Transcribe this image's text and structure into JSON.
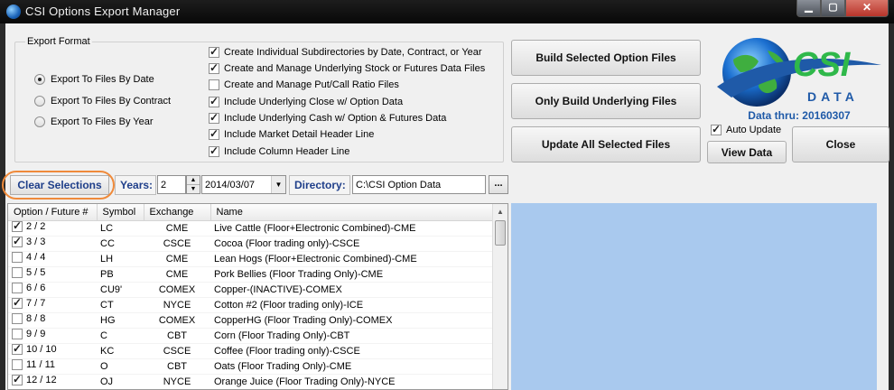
{
  "window": {
    "title": "CSI Options Export Manager",
    "min": "▁",
    "max": "▢",
    "close": "✕"
  },
  "export_format": {
    "legend": "Export Format",
    "radios": [
      {
        "label": "Export To Files By Date",
        "selected": true
      },
      {
        "label": "Export To Files By Contract",
        "selected": false
      },
      {
        "label": "Export To Files By Year",
        "selected": false
      }
    ],
    "checks": [
      {
        "label": "Create Individual Subdirectories by Date, Contract, or Year",
        "checked": true
      },
      {
        "label": "Create and Manage Underlying Stock or Futures Data Files",
        "checked": true
      },
      {
        "label": "Create and Manage Put/Call Ratio Files",
        "checked": false
      },
      {
        "label": "Include Underlying Close w/ Option Data",
        "checked": true
      },
      {
        "label": "Include Underlying Cash w/ Option & Futures Data",
        "checked": true
      },
      {
        "label": "Include Market Detail Header Line",
        "checked": true
      },
      {
        "label": "Include Column Header Line",
        "checked": true
      }
    ]
  },
  "buttons": {
    "build_selected": "Build Selected Option Files",
    "only_underlying": "Only Build Underlying Files",
    "update_all": "Update All Selected Files",
    "view_data": "View Data",
    "close": "Close",
    "clear": "Clear Selections",
    "browse": "..."
  },
  "logo": {
    "text": "CSI",
    "subtext": "DATA",
    "data_thru": "Data thru: 20160307"
  },
  "auto_update": {
    "label": "Auto Update",
    "checked": true
  },
  "toolbar": {
    "years_label": "Years:",
    "years_value": "2",
    "date_value": "2014/03/07",
    "directory_label": "Directory:",
    "directory_value": "C:\\CSI Option Data"
  },
  "table": {
    "columns": [
      "Option / Future #",
      "Symbol",
      "Exchange",
      "Name"
    ],
    "rows": [
      {
        "num": "2 / 2",
        "symbol": "LC",
        "exchange": "CME",
        "name": "Live Cattle (Floor+Electronic Combined)-CME",
        "checked": true
      },
      {
        "num": "3 / 3",
        "symbol": "CC",
        "exchange": "CSCE",
        "name": "Cocoa (Floor trading only)-CSCE",
        "checked": true
      },
      {
        "num": "4 / 4",
        "symbol": "LH",
        "exchange": "CME",
        "name": "Lean Hogs (Floor+Electronic Combined)-CME",
        "checked": false
      },
      {
        "num": "5 / 5",
        "symbol": "PB",
        "exchange": "CME",
        "name": "Pork Bellies (Floor Trading Only)-CME",
        "checked": false
      },
      {
        "num": "6 / 6",
        "symbol": "CU9'",
        "exchange": "COMEX",
        "name": "Copper-(INACTIVE)-COMEX",
        "checked": false
      },
      {
        "num": "7 / 7",
        "symbol": "CT",
        "exchange": "NYCE",
        "name": "Cotton #2 (Floor trading only)-ICE",
        "checked": true
      },
      {
        "num": "8 / 8",
        "symbol": "HG",
        "exchange": "COMEX",
        "name": "CopperHG (Floor Trading Only)-COMEX",
        "checked": false
      },
      {
        "num": "9 / 9",
        "symbol": "C",
        "exchange": "CBT",
        "name": "Corn (Floor Trading Only)-CBT",
        "checked": false
      },
      {
        "num": "10 / 10",
        "symbol": "KC",
        "exchange": "CSCE",
        "name": "Coffee (Floor trading only)-CSCE",
        "checked": true
      },
      {
        "num": "11 / 11",
        "symbol": "O",
        "exchange": "CBT",
        "name": "Oats (Floor Trading Only)-CME",
        "checked": false
      },
      {
        "num": "12 / 12",
        "symbol": "OJ",
        "exchange": "NYCE",
        "name": "Orange Juice (Floor Trading Only)-NYCE",
        "checked": true
      }
    ]
  },
  "colors": {
    "accent_label": "#1f3f8a",
    "highlight_ring": "#ef8a3a",
    "panel_blue": "#a9c9ee",
    "logo_green": "#2fb84a",
    "logo_blue": "#1f5aa8"
  }
}
